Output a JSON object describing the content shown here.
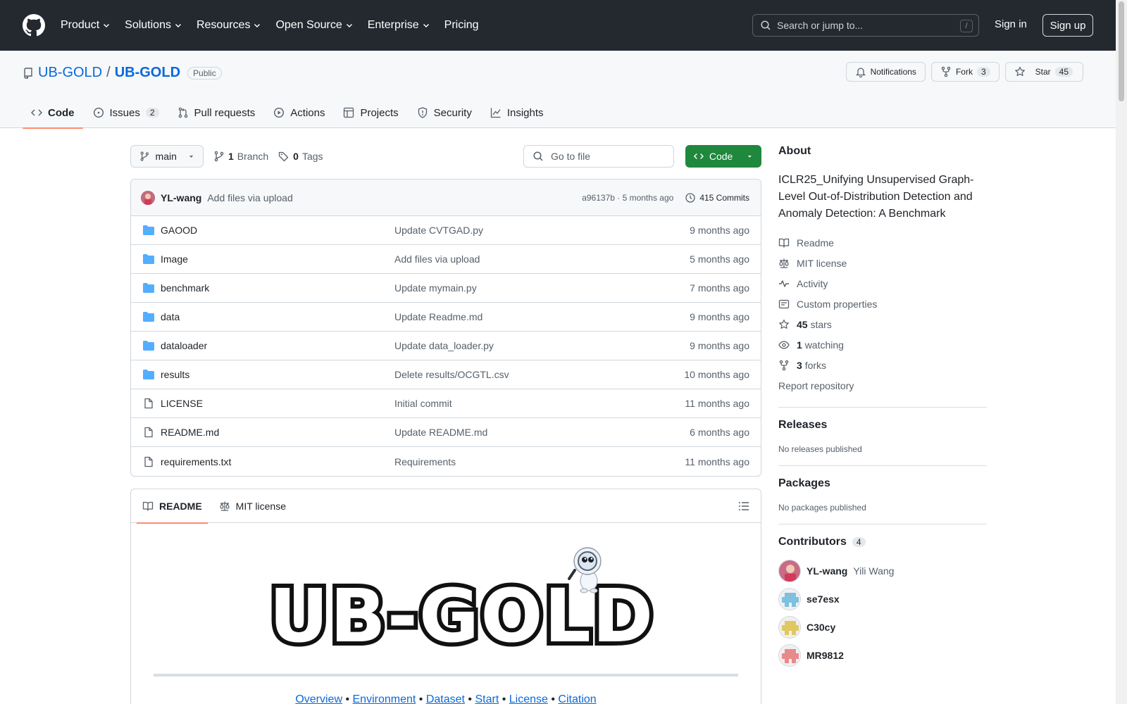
{
  "header": {
    "nav": [
      "Product",
      "Solutions",
      "Resources",
      "Open Source",
      "Enterprise",
      "Pricing"
    ],
    "search_placeholder": "Search or jump to...",
    "search_shortcut": "/",
    "signin": "Sign in",
    "signup": "Sign up"
  },
  "repo": {
    "owner": "UB-GOLD",
    "separator": "/",
    "name": "UB-GOLD",
    "visibility": "Public",
    "notifications_label": "Notifications",
    "fork_label": "Fork",
    "fork_count": "3",
    "star_label": "Star",
    "star_count": "45"
  },
  "tabs": [
    {
      "label": "Code",
      "icon": "code-icon"
    },
    {
      "label": "Issues",
      "icon": "issue-icon",
      "count": "2"
    },
    {
      "label": "Pull requests",
      "icon": "pull-request-icon"
    },
    {
      "label": "Actions",
      "icon": "play-icon"
    },
    {
      "label": "Projects",
      "icon": "table-icon"
    },
    {
      "label": "Security",
      "icon": "shield-icon"
    },
    {
      "label": "Insights",
      "icon": "graph-icon"
    }
  ],
  "toolbar": {
    "branch": "main",
    "branch_count": "1",
    "branch_label": "Branch",
    "tag_count": "0",
    "tag_label": "Tags",
    "goto_placeholder": "Go to file",
    "code_button": "Code"
  },
  "latest_commit": {
    "author": "YL-wang",
    "message": "Add files via upload",
    "hash_time": "a96137b · 5 months ago",
    "commits": "415 Commits"
  },
  "files": [
    {
      "name": "GAOOD",
      "type": "dir",
      "commit": "Update CVTGAD.py",
      "time": "9 months ago"
    },
    {
      "name": "Image",
      "type": "dir",
      "commit": "Add files via upload",
      "time": "5 months ago"
    },
    {
      "name": "benchmark",
      "type": "dir",
      "commit": "Update mymain.py",
      "time": "7 months ago"
    },
    {
      "name": "data",
      "type": "dir",
      "commit": "Update Readme.md",
      "time": "9 months ago"
    },
    {
      "name": "dataloader",
      "type": "dir",
      "commit": "Update data_loader.py",
      "time": "9 months ago"
    },
    {
      "name": "results",
      "type": "dir",
      "commit": "Delete results/OCGTL.csv",
      "time": "10 months ago"
    },
    {
      "name": "LICENSE",
      "type": "file",
      "commit": "Initial commit",
      "time": "11 months ago"
    },
    {
      "name": "README.md",
      "type": "file",
      "commit": "Update README.md",
      "time": "6 months ago"
    },
    {
      "name": "requirements.txt",
      "type": "file",
      "commit": "Requirements",
      "time": "11 months ago"
    }
  ],
  "readme": {
    "tab_readme": "README",
    "tab_license": "MIT license",
    "logo_text": "UB-GOLD",
    "links": [
      "Overview",
      "Environment",
      "Dataset",
      "Start",
      "License",
      "Citation"
    ],
    "link_sep": " • "
  },
  "about": {
    "heading": "About",
    "description": "ICLR25_Unifying Unsupervised Graph-Level Out-of-Distribution Detection and Anomaly Detection: A Benchmark",
    "readme": "Readme",
    "license": "MIT license",
    "activity": "Activity",
    "custom_properties": "Custom properties",
    "stars_count": "45",
    "stars_label": "stars",
    "watching_count": "1",
    "watching_label": "watching",
    "forks_count": "3",
    "forks_label": "forks",
    "report": "Report repository"
  },
  "releases": {
    "heading": "Releases",
    "empty": "No releases published"
  },
  "packages": {
    "heading": "Packages",
    "empty": "No packages published"
  },
  "contributors": {
    "heading": "Contributors",
    "count": "4",
    "list": [
      {
        "login": "YL-wang",
        "name": "Yili Wang",
        "color": "#c96b84"
      },
      {
        "login": "se7esx",
        "name": "",
        "color": "#7ec0e0"
      },
      {
        "login": "C30cy",
        "name": "",
        "color": "#e0c860"
      },
      {
        "login": "MR9812",
        "name": "",
        "color": "#e88a8a"
      }
    ]
  },
  "colors": {
    "header_bg": "#24292f",
    "link": "#0969da",
    "code_button": "#1f883d",
    "tab_underline": "#fd8c73",
    "folder": "#54aeff"
  }
}
